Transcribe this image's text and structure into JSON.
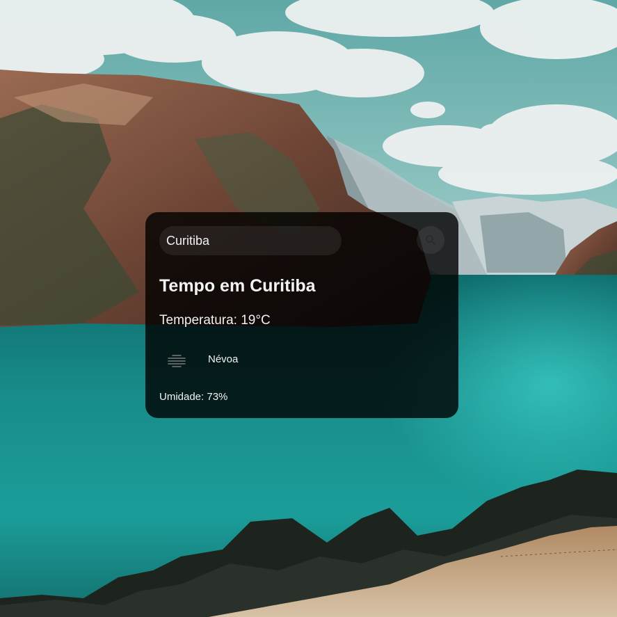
{
  "search": {
    "value": "Curitiba",
    "placeholder": "",
    "icon": "search-icon"
  },
  "weather": {
    "title": "Tempo em Curitiba",
    "temperature": "Temperatura: 19°C",
    "condition_icon": "mist-icon",
    "condition": "Névoa",
    "humidity": "Umidade: 73%"
  },
  "colors": {
    "card_background": "#000000",
    "text": "#ffffff",
    "water": "#1aa9a4",
    "sky": "#6fb7b3"
  }
}
